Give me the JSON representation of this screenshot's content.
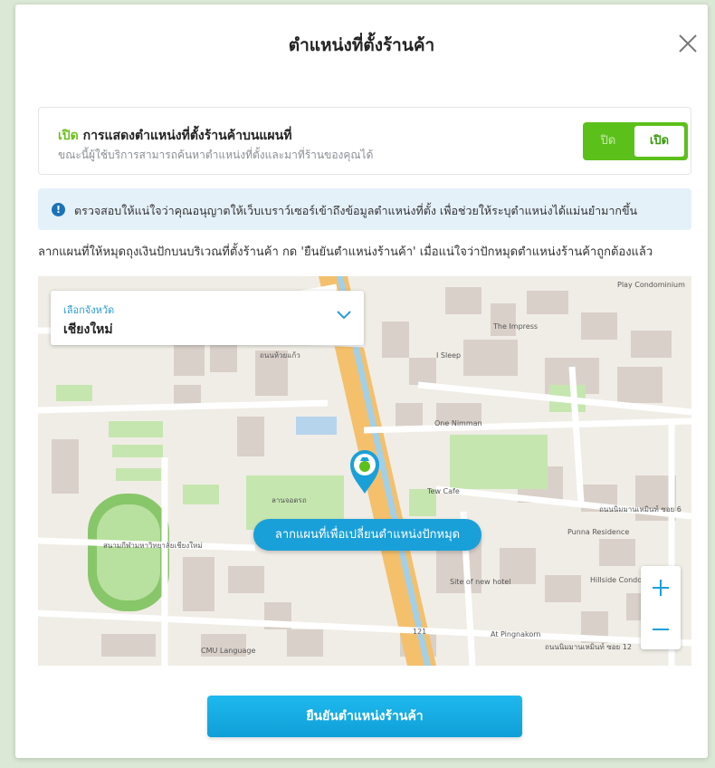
{
  "modal": {
    "title": "ตำแหน่งที่ตั้งร้านค้า",
    "close_icon": "close-icon"
  },
  "visibility": {
    "status_word": "เปิด",
    "heading": "การแสดงตำแหน่งที่ตั้งร้านค้าบนแผนที่",
    "description": "ขณะนี้ผู้ใช้บริการสามารถค้นหาตำแหน่งที่ตั้งและมาที่ร้านของคุณได้",
    "toggle": {
      "off_label": "ปิด",
      "on_label": "เปิด",
      "state": "on",
      "active_color": "#5cc01b"
    }
  },
  "notice": {
    "icon": "info-icon",
    "text": "ตรวจสอบให้แน่ใจว่าคุณอนุญาตให้เว็บเบราว์เซอร์เข้าถึงข้อมูลตำแหน่งที่ตั้ง เพื่อช่วยให้ระบุตำแหน่งได้แม่นยำมากขึ้น"
  },
  "instruction": "ลากแผนที่ให้หมุดถุงเงินปักบนบริเวณที่ตั้งร้านค้า กด 'ยืนยันตำแหน่งร้านค้า' เมื่อแน่ใจว่าปักหมุดตำแหน่งร้านค้าถูกต้องแล้ว",
  "map": {
    "province_select": {
      "label": "เลือกจังหวัด",
      "value": "เชียงใหม่"
    },
    "drag_hint": "ลากแผนที่เพื่อเปลี่ยนตำแหน่งปักหมุด",
    "zoom_in_icon": "plus-icon",
    "zoom_out_icon": "minus-icon",
    "place_labels": {
      "impress": "The Impress",
      "one_nimman": "One Nimman",
      "nimman_rd": "ถนนนิมมานเหมินท์ ซอย 12",
      "nimman_rd_6": "ถนนนิมมานเหมินท์ ซอย 6",
      "huay_kaew": "ถนนห้วยแก้ว",
      "stadium": "สนามกีฬามหาวิทยาลัยเชียงใหม่",
      "parking": "ลานจอดรถ",
      "tew_cafe": "Tew Cafe",
      "site_hotel": "Site of new hotel",
      "cmu_language": "CMU Language",
      "punna": "Punna Residence",
      "hillside": "Hillside Condo",
      "road_121": "121",
      "sleep": "I Sleep",
      "at_pingnakorn": "At Pingnakorn",
      "play_condo": "Play Condominium"
    }
  },
  "confirm_button": "ยืนยันตำแหน่งร้านค้า"
}
